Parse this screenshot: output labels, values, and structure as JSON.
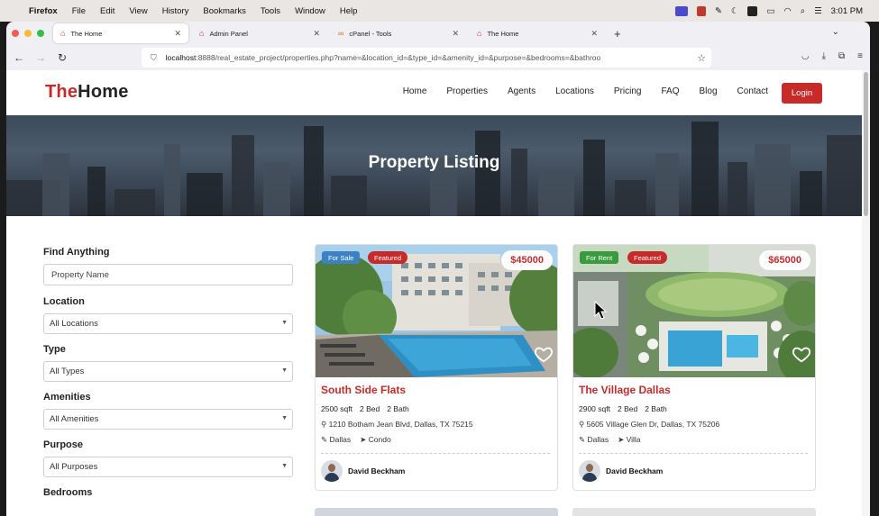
{
  "menubar": {
    "apple": "",
    "items": [
      "Firefox",
      "File",
      "Edit",
      "View",
      "History",
      "Bookmarks",
      "Tools",
      "Window",
      "Help"
    ],
    "time": "3:01 PM"
  },
  "browser": {
    "tabs": [
      {
        "title": "The Home",
        "active": true
      },
      {
        "title": "Admin Panel",
        "active": false
      },
      {
        "title": "cPanel - Tools",
        "active": false
      },
      {
        "title": "The Home",
        "active": false
      }
    ],
    "url_host": "localhost",
    "url_rest": ":8888/real_estate_project/properties.php?name=&location_id=&type_id=&amenity_id=&purpose=&bedrooms=&bathroo"
  },
  "site": {
    "logo_red": "The",
    "logo_dark": "Home",
    "nav": [
      "Home",
      "Properties",
      "Agents",
      "Locations",
      "Pricing",
      "FAQ",
      "Blog",
      "Contact"
    ],
    "login_label": "Login",
    "hero_title": "Property Listing"
  },
  "filters": {
    "find_label": "Find Anything",
    "find_placeholder": "Property Name",
    "location_label": "Location",
    "location_value": "All Locations",
    "type_label": "Type",
    "type_value": "All Types",
    "amenities_label": "Amenities",
    "amenities_value": "All Amenities",
    "purpose_label": "Purpose",
    "purpose_value": "All Purposes",
    "bedrooms_label": "Bedrooms"
  },
  "listings": [
    {
      "purpose_badge": "For Sale",
      "purpose_color": "#3b82c4",
      "featured_badge": "Featured",
      "price": "$45000",
      "title": "South Side Flats",
      "sqft": "2500 sqft",
      "beds": "2 Bed",
      "baths": "2 Bath",
      "address": "1210 Botham Jean Blvd, Dallas, TX 75215",
      "location": "Dallas",
      "type": "Condo",
      "agent": "David Beckham"
    },
    {
      "purpose_badge": "For Rent",
      "purpose_color": "#3a9a3e",
      "featured_badge": "Featured",
      "price": "$65000",
      "title": "The Village Dallas",
      "sqft": "2900 sqft",
      "beds": "2 Bed",
      "baths": "2 Bath",
      "address": "5605 Village Glen Dr, Dallas, TX 75206",
      "location": "Dallas",
      "type": "Villa",
      "agent": "David Beckham"
    }
  ],
  "colors": {
    "brand_red": "#c82a2a",
    "featured_red": "#c82a2a"
  }
}
